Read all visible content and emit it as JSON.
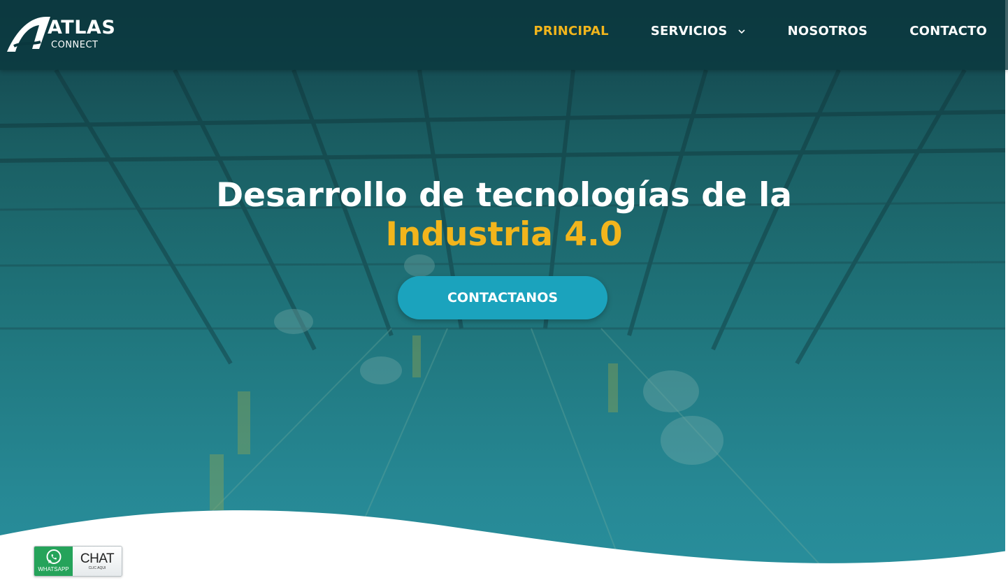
{
  "brand": {
    "name": "ATLAS",
    "tagline": "CONNECT"
  },
  "nav": {
    "items": [
      {
        "label": "PRINCIPAL"
      },
      {
        "label": "SERVICIOS"
      },
      {
        "label": "NOSOTROS"
      },
      {
        "label": "CONTACTO"
      }
    ]
  },
  "hero": {
    "title_line1": "Desarrollo de tecnologías de la",
    "title_line2": "Industria 4.0",
    "cta_label": "CONTACTANOS"
  },
  "chat_widget": {
    "left_label": "WHATSAPP",
    "title": "CHAT",
    "subtitle": "CLIC AQUI"
  },
  "colors": {
    "accent": "#f2b51c",
    "cta": "#1ba3bd",
    "header": "#0a373e",
    "whatsapp": "#25a35a"
  },
  "icons": {
    "logo": "atlas-logo-icon",
    "dropdown": "chevron-down-icon",
    "whatsapp": "whatsapp-icon"
  }
}
